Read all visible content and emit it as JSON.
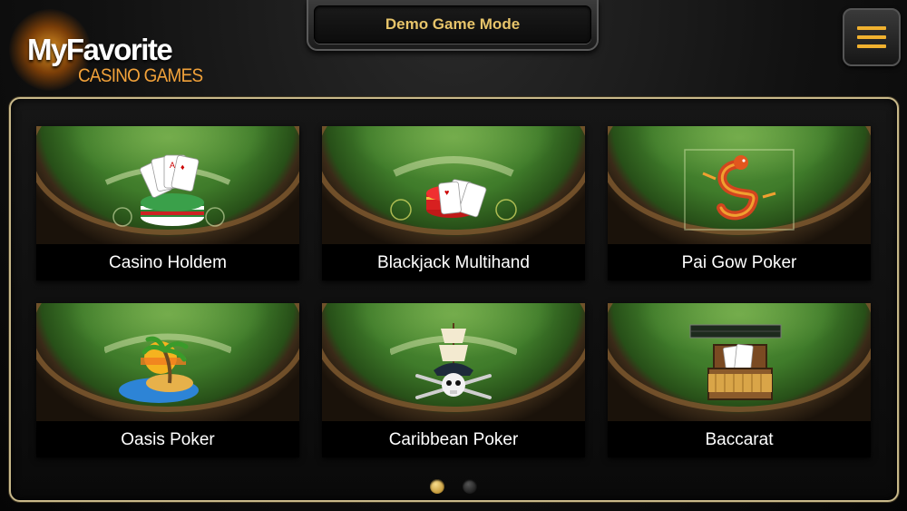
{
  "logo": {
    "line1": "MyFavorite",
    "line2": "CASINO GAMES"
  },
  "header": {
    "mode_label": "Demo Game Mode"
  },
  "menu": {
    "icon": "hamburger-menu-icon"
  },
  "colors": {
    "accent_gold": "#e7c46a",
    "frame_border": "#c9b98a",
    "felt_green": "#3f7b2a"
  },
  "games": [
    {
      "title": "Casino Holdem",
      "art": "poker-chips-cards"
    },
    {
      "title": "Blackjack Multihand",
      "art": "blackjack-chips-cards"
    },
    {
      "title": "Pai Gow Poker",
      "art": "dragon"
    },
    {
      "title": "Oasis Poker",
      "art": "palm-island"
    },
    {
      "title": "Caribbean Poker",
      "art": "pirate-skull-ship"
    },
    {
      "title": "Baccarat",
      "art": "treasure-chest-cards"
    }
  ],
  "pagination": {
    "pages": 2,
    "current": 1
  }
}
